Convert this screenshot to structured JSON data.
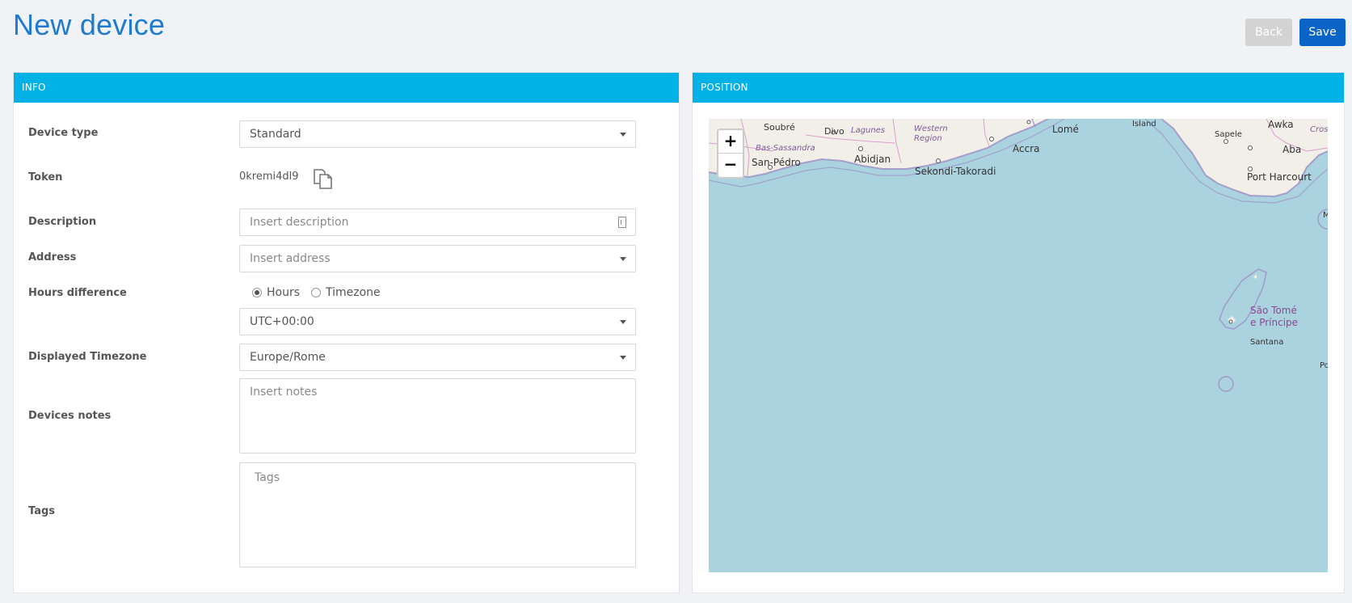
{
  "header": {
    "title": "New device",
    "back_label": "Back",
    "save_label": "Save"
  },
  "info_panel": {
    "title": "INFO",
    "device_type": {
      "label": "Device type",
      "value": "Standard"
    },
    "token": {
      "label": "Token",
      "value": "0kremi4dl9"
    },
    "description": {
      "label": "Description",
      "placeholder": "Insert description"
    },
    "address": {
      "label": "Address",
      "placeholder": "Insert address"
    },
    "hours_difference": {
      "label": "Hours difference",
      "options": [
        "Hours",
        "Timezone"
      ],
      "selected": "Hours",
      "value": "UTC+00:00"
    },
    "displayed_timezone": {
      "label": "Displayed Timezone",
      "value": "Europe/Rome"
    },
    "notes": {
      "label": "Devices notes",
      "placeholder": "Insert notes"
    },
    "tags": {
      "label": "Tags",
      "placeholder": "Tags"
    }
  },
  "position_panel": {
    "title": "POSITION",
    "map": {
      "zoom_in": "+",
      "zoom_out": "−",
      "labels": {
        "soubre": "Soubré",
        "divo": "Divo",
        "lagunes": "Lagunes",
        "western_region": "Western\nRegion",
        "lome": "Lomé",
        "island": "Island",
        "sapele": "Sapele",
        "awka": "Awka",
        "cross": "Cross",
        "bas_sassandra": "Bas-Sassandra",
        "accra": "Accra",
        "aba": "Aba",
        "san_pedro": "San-Pédro",
        "abidjan": "Abidjan",
        "sekondi": "Sekondi-Takoradi",
        "port_harcourt": "Port Harcourt",
        "sao_tome": "São Tomé\ne Príncipe",
        "santana": "Santana",
        "po": "Po",
        "m": "M"
      }
    }
  }
}
